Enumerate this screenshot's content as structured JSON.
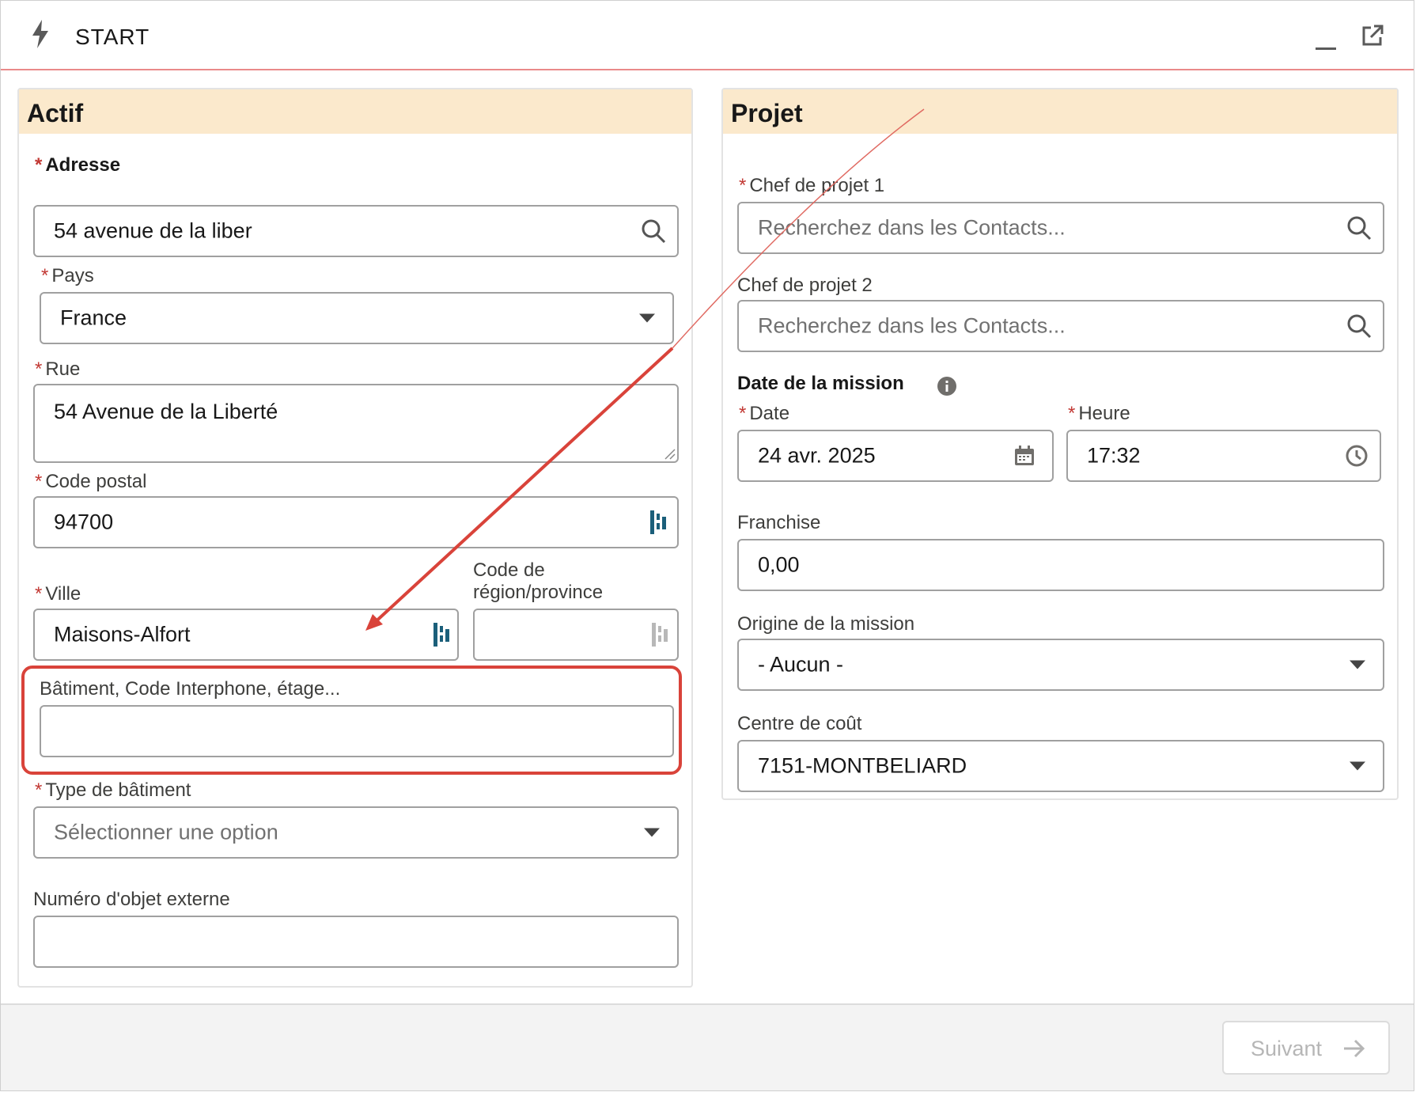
{
  "window": {
    "title": "START"
  },
  "actif": {
    "title": "Actif",
    "adresse": {
      "label": "Adresse",
      "value": "54 avenue de la liber"
    },
    "pays": {
      "label": "Pays",
      "value": "France"
    },
    "rue": {
      "label": "Rue",
      "value": "54 Avenue de la Liberté"
    },
    "code_postal": {
      "label": "Code postal",
      "value": "94700"
    },
    "ville": {
      "label": "Ville",
      "value": "Maisons-Alfort"
    },
    "region": {
      "label_line1": "Code de",
      "label_line2": "région/province",
      "value": ""
    },
    "batiment_info": {
      "label": "Bâtiment, Code Interphone, étage...",
      "value": ""
    },
    "type_batiment": {
      "label": "Type de bâtiment",
      "placeholder": "Sélectionner une option"
    },
    "numero_objet": {
      "label": "Numéro d'objet externe",
      "value": ""
    }
  },
  "projet": {
    "title": "Projet",
    "chef1": {
      "label": "Chef de projet 1",
      "placeholder": "Recherchez dans les Contacts..."
    },
    "chef2": {
      "label": "Chef de projet 2",
      "placeholder": "Recherchez dans les Contacts..."
    },
    "date_mission": {
      "label": "Date de la mission"
    },
    "date": {
      "label": "Date",
      "value": "24 avr. 2025"
    },
    "heure": {
      "label": "Heure",
      "value": "17:32"
    },
    "franchise": {
      "label": "Franchise",
      "value": "0,00"
    },
    "origine": {
      "label": "Origine de la mission",
      "value": "- Aucun -"
    },
    "centre_cout": {
      "label": "Centre de coût",
      "value": "7151-MONTBELIARD"
    }
  },
  "footer": {
    "next_label": "Suivant"
  },
  "colors": {
    "panel_header": "#fbe9cc",
    "required": "#c23934",
    "annotation": "#d9433a",
    "map_icon": "#1b5f7a"
  }
}
